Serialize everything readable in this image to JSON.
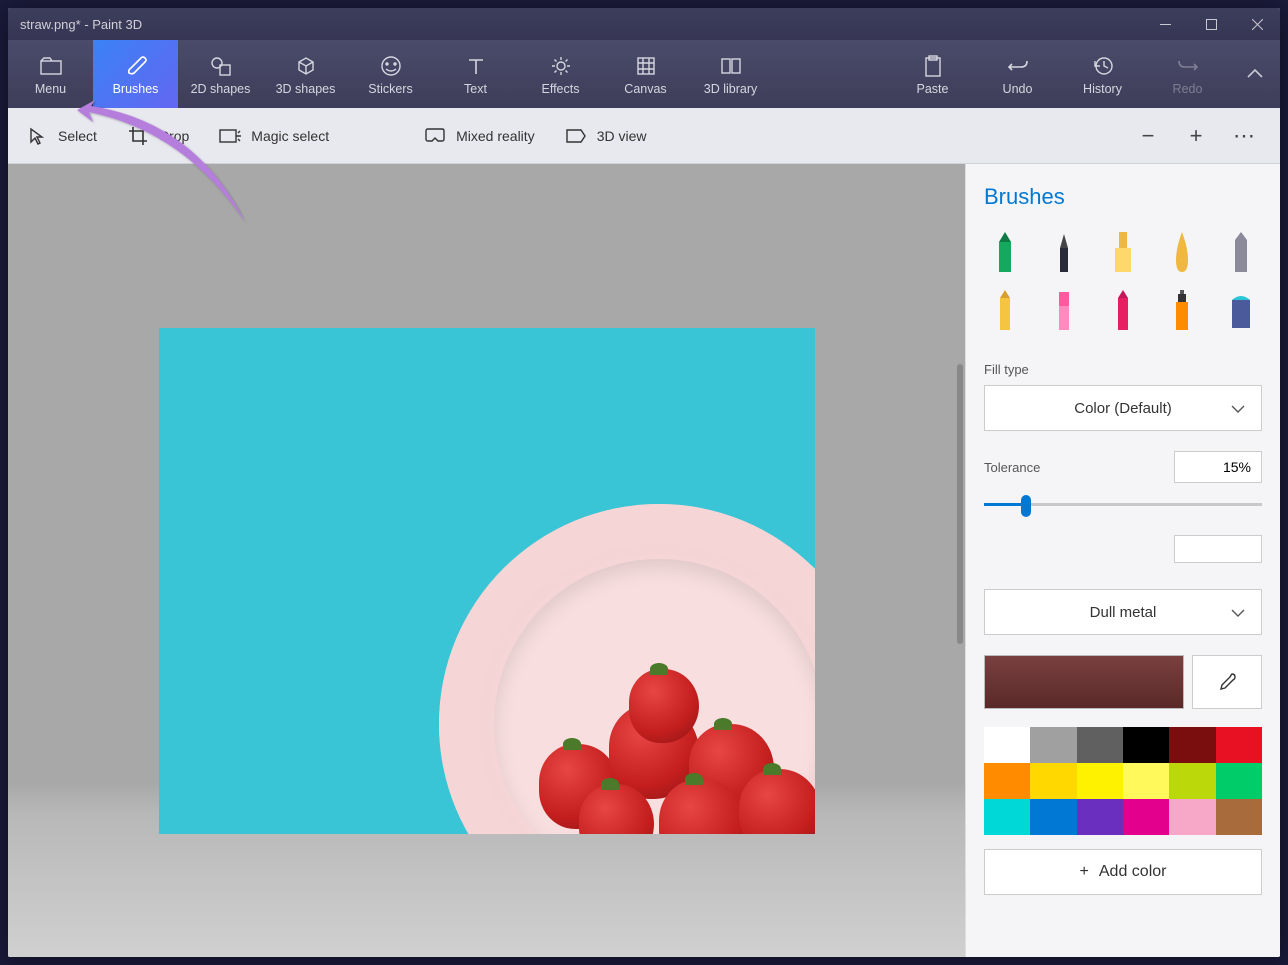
{
  "title": "straw.png* - Paint 3D",
  "ribbon": {
    "menu": "Menu",
    "brushes": "Brushes",
    "shapes2d": "2D shapes",
    "shapes3d": "3D shapes",
    "stickers": "Stickers",
    "text": "Text",
    "effects": "Effects",
    "canvas": "Canvas",
    "library": "3D library",
    "paste": "Paste",
    "undo": "Undo",
    "history": "History",
    "redo": "Redo"
  },
  "toolbar": {
    "select": "Select",
    "crop": "Crop",
    "magic": "Magic select",
    "mixed": "Mixed reality",
    "view3d": "3D view"
  },
  "sidebar": {
    "title": "Brushes",
    "fill_type_label": "Fill type",
    "fill_type_value": "Color (Default)",
    "tolerance_label": "Tolerance",
    "tolerance_value": "15%",
    "material_value": "Dull metal",
    "add_color": "Add color"
  },
  "swatches": [
    "#ffffff",
    "#a0a0a0",
    "#606060",
    "#000000",
    "#7a0e0e",
    "#e81123",
    "#ff8c00",
    "#ffd800",
    "#fff200",
    "#fff95b",
    "#bad80a",
    "#00cc6a",
    "#00d8d8",
    "#0078d4",
    "#6b2fbf",
    "#e3008c",
    "#f7a8c8",
    "#a86b3c"
  ]
}
